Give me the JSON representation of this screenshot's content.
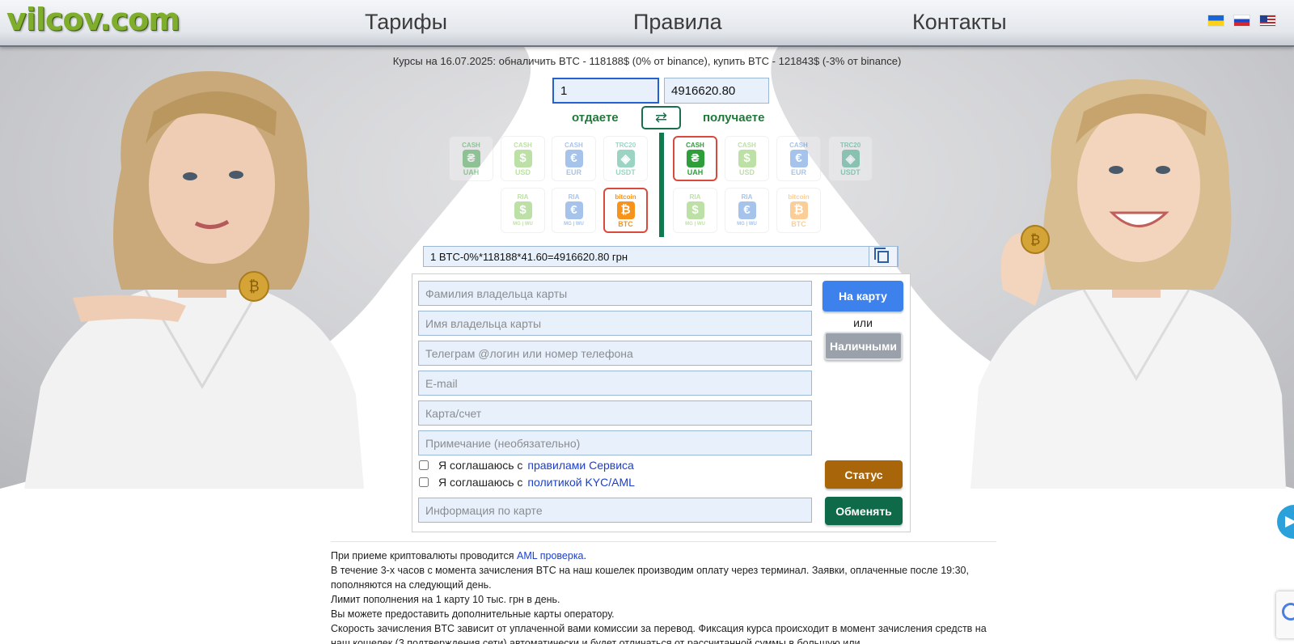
{
  "header": {
    "logo": "vilcov.com",
    "nav": [
      "Тарифы",
      "Правила",
      "Контакты"
    ],
    "flags": [
      "ua-flag",
      "ru-flag",
      "us-flag"
    ]
  },
  "rates_line": "Курсы на 16.07.2025: обналичить BTC - 118188$ (0% от binance), купить BTC - 121843$ (-3% от binance)",
  "exchange": {
    "give_value": "1",
    "get_value": "4916620.80",
    "give_label": "отдаете",
    "get_label": "получаете",
    "formula": "1 BTC-0%*118188*41.60=4916620.80 грн"
  },
  "give_currencies": [
    {
      "top": "CASH",
      "symbol": "₴",
      "bottom": "UAH",
      "color": "#2e9e3a",
      "state": "faded"
    },
    {
      "top": "CASH",
      "symbol": "$",
      "bottom": "USD",
      "color": "#6dbb3a",
      "state": "faded"
    },
    {
      "top": "CASH",
      "symbol": "€",
      "bottom": "EUR",
      "color": "#3a7bd5",
      "state": "faded"
    },
    {
      "top": "TRC20",
      "symbol": "◈",
      "bottom": "USDT",
      "color": "#26a17b",
      "state": "faded"
    },
    {
      "top": "RIA",
      "symbol": "$",
      "bottom": "MG | WU",
      "color": "#6dbb3a",
      "state": "faded"
    },
    {
      "top": "RIA",
      "symbol": "€",
      "bottom": "MG | WU",
      "color": "#3a7bd5",
      "state": "faded"
    },
    {
      "top": "bitcoin",
      "symbol": "₿",
      "bottom": "BTC",
      "color": "#f7931a",
      "state": "selected"
    }
  ],
  "get_currencies": [
    {
      "top": "CASH",
      "symbol": "₴",
      "bottom": "UAH",
      "color": "#2e9e3a",
      "state": "selected"
    },
    {
      "top": "CASH",
      "symbol": "$",
      "bottom": "USD",
      "color": "#6dbb3a",
      "state": "faded"
    },
    {
      "top": "CASH",
      "symbol": "€",
      "bottom": "EUR",
      "color": "#3a7bd5",
      "state": "faded"
    },
    {
      "top": "TRC20",
      "symbol": "◈",
      "bottom": "USDT",
      "color": "#26a17b",
      "state": "faded"
    },
    {
      "top": "RIA",
      "symbol": "$",
      "bottom": "MG | WU",
      "color": "#6dbb3a",
      "state": "faded"
    },
    {
      "top": "RIA",
      "symbol": "€",
      "bottom": "MG | WU",
      "color": "#3a7bd5",
      "state": "faded"
    },
    {
      "top": "bitcoin",
      "symbol": "₿",
      "bottom": "BTC",
      "color": "#f7931a",
      "state": "faded"
    }
  ],
  "form": {
    "surname_placeholder": "Фамилия владельца карты",
    "name_placeholder": "Имя владельца карты",
    "contact_placeholder": "Телеграм @логин или номер телефона",
    "email_placeholder": "E-mail",
    "card_placeholder": "Карта/счет",
    "note_placeholder": "Примечание (необязательно)",
    "card_info_placeholder": "Информация по карте",
    "agree_prefix": "Я соглашаюсь с",
    "rules_link": "правилами Сервиса",
    "kyc_link": "политикой KYC/AML"
  },
  "buttons": {
    "to_card": "На карту",
    "or": "или",
    "cash": "Наличными",
    "status": "Статус",
    "exchange": "Обменять"
  },
  "info": {
    "line1_prefix": "При приеме криптовалюты проводится",
    "line1_link": "AML проверка",
    "line1_suffix": ".",
    "line2": "В течение 3-х часов с момента зачисления BTC на наш кошелек производим оплату через терминал. Заявки, оплаченные после 19:30, пополняются на следующий день.",
    "line3": "Лимит пополнения на 1 карту 10 тыс. грн в день.",
    "line4": "Вы можете предоставить дополнительные карты оператору.",
    "line5": "Скорость зачисления BTC зависит от уплаченной вами комиссии за перевод. Фиксация курса происходит в момент зачисления средств на наш кошелек (3 подтверждения сети) автоматически и будет отличаться от рассчитанной суммы в большую или"
  }
}
